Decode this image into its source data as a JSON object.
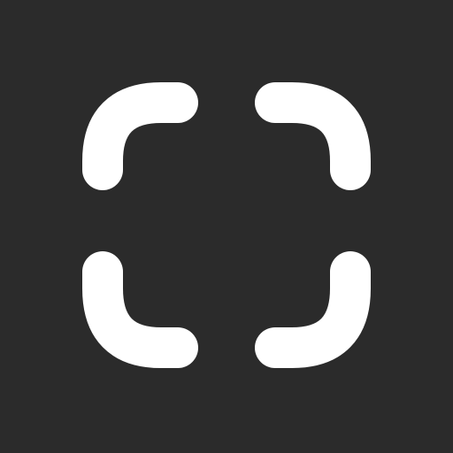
{
  "icon": {
    "name": "scan-frame-icon",
    "background_color": "#2b2b2b",
    "foreground_color": "#ffffff"
  }
}
